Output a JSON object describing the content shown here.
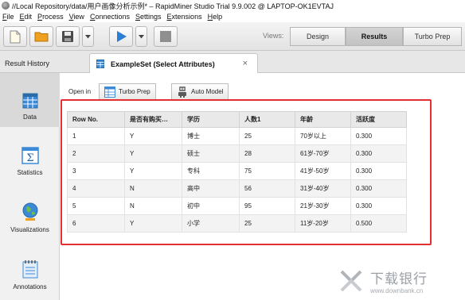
{
  "window": {
    "title": "//Local Repository/data/用户画像分析示例* – RapidMiner Studio Trial 9.9.002 @ LAPTOP-OK1EVTAJ"
  },
  "menu": [
    {
      "label": "File",
      "mnemonic": "F",
      "rest": "ile"
    },
    {
      "label": "Edit",
      "mnemonic": "E",
      "rest": "dit"
    },
    {
      "label": "Process",
      "mnemonic": "P",
      "rest": "rocess"
    },
    {
      "label": "View",
      "mnemonic": "V",
      "rest": "iew"
    },
    {
      "label": "Connections",
      "mnemonic": "C",
      "rest": "onnections"
    },
    {
      "label": "Settings",
      "mnemonic": "S",
      "rest": "ettings"
    },
    {
      "label": "Extensions",
      "mnemonic": "E",
      "rest": "xtensions"
    },
    {
      "label": "Help",
      "mnemonic": "H",
      "rest": "elp"
    }
  ],
  "toolbar": {
    "icons": [
      "new-process-icon",
      "open-folder-icon",
      "save-icon",
      "dropdown-arrow-icon",
      "run-play-icon",
      "dropdown-arrow-icon",
      "stop-icon"
    ],
    "views_label": "Views:",
    "views": [
      {
        "label": "Design",
        "active": false
      },
      {
        "label": "Results",
        "active": true
      },
      {
        "label": "Turbo Prep",
        "active": false
      }
    ]
  },
  "tabs": {
    "result_history": "Result History",
    "active_tab": "ExampleSet (Select Attributes)",
    "close_glyph": "×"
  },
  "sidebar": [
    {
      "label": "Data",
      "icon": "data-grid-icon",
      "active": true
    },
    {
      "label": "Statistics",
      "icon": "statistics-sigma-icon",
      "active": false
    },
    {
      "label": "Visualizations",
      "icon": "visualizations-globe-icon",
      "active": false
    },
    {
      "label": "Annotations",
      "icon": "annotations-note-icon",
      "active": false
    }
  ],
  "open_in": {
    "label": "Open in",
    "turbo_prep": "Turbo Prep",
    "auto_model": "Auto Model"
  },
  "table": {
    "columns": [
      "Row No.",
      "是否有购买…",
      "学历",
      "人数1",
      "年龄",
      "活跃度"
    ],
    "rows": [
      [
        "1",
        "Y",
        "博士",
        "25",
        "70岁以上",
        "0.300"
      ],
      [
        "2",
        "Y",
        "硕士",
        "28",
        "61岁-70岁",
        "0.300"
      ],
      [
        "3",
        "Y",
        "专科",
        "75",
        "41岁-50岁",
        "0.300"
      ],
      [
        "4",
        "N",
        "高中",
        "56",
        "31岁-40岁",
        "0.300"
      ],
      [
        "5",
        "N",
        "初中",
        "95",
        "21岁-30岁",
        "0.300"
      ],
      [
        "6",
        "Y",
        "小学",
        "25",
        "11岁-20岁",
        "0.500"
      ]
    ]
  },
  "watermark": {
    "cn": "下载银行",
    "en": "www.downbank.cn"
  },
  "colors": {
    "highlight_border": "#e03030",
    "run_blue": "#2a7fd4",
    "folder_orange": "#f0a020"
  }
}
